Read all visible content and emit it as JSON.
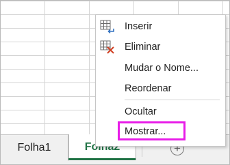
{
  "sheet_tabs": [
    {
      "label": "Folha1",
      "active": false
    },
    {
      "label": "Folha2",
      "active": true
    }
  ],
  "add_sheet_icon": "plus-circle-icon",
  "context_menu": {
    "items": [
      {
        "label": "Inserir",
        "icon": "insert-sheet-icon"
      },
      {
        "label": "Eliminar",
        "icon": "delete-sheet-icon"
      },
      {
        "label": "Mudar o Nome...",
        "icon": null
      },
      {
        "label": "Reordenar",
        "icon": null
      },
      {
        "label": "Ocultar",
        "icon": null
      },
      {
        "label": "Mostrar...",
        "icon": null,
        "highlighted": true
      }
    ]
  },
  "colors": {
    "active_tab": "#217346",
    "highlight_box": "#e81ce8",
    "delete_x": "#d2462a",
    "insert_arrow": "#2f6fbf"
  }
}
